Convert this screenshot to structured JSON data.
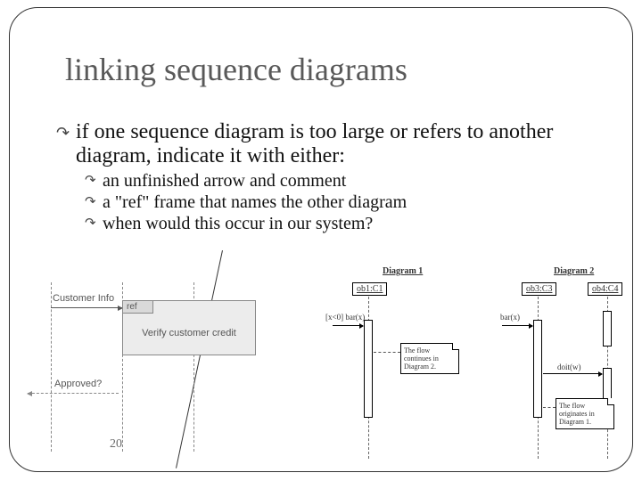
{
  "title": "linking sequence diagrams",
  "page_number": "20",
  "bullets": {
    "main": "if one sequence diagram is too large or refers to another diagram, indicate it with either:",
    "sub": [
      "an unfinished arrow and comment",
      "a \"ref\" frame that names the other diagram",
      "when would this occur in our system?"
    ]
  },
  "left_diagram": {
    "msg1": "Customer Info",
    "ref_tab": "ref",
    "ref_label": "Verify customer credit",
    "msg2": "Approved?"
  },
  "right_diagram": {
    "title1": "Diagram 1",
    "title2": "Diagram 2",
    "obj1": "ob1:C1",
    "obj3": "ob3:C3",
    "obj4": "ob4:C4",
    "msg1": "[x<0] bar(x)",
    "msg3": "bar(x)",
    "msg4": "doit(w)",
    "note1": "The flow continues in Diagram 2.",
    "note2": "The flow originates in Diagram 1."
  }
}
